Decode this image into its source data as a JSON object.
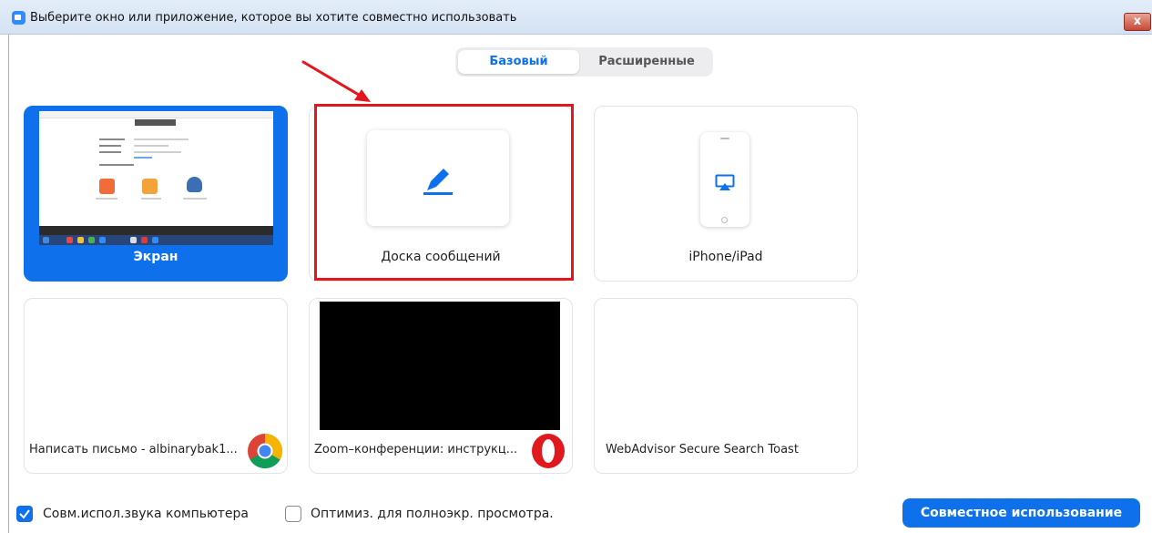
{
  "window": {
    "title": "Выберите окно или приложение, которое вы хотите совместно использовать",
    "close_glyph": "x"
  },
  "tabs": [
    {
      "label": "Базовый",
      "active": true
    },
    {
      "label": "Расширенные",
      "active": false
    }
  ],
  "share_options": [
    {
      "label": "Экран",
      "icon": "screen-thumbnail",
      "selected": true
    },
    {
      "label": "Доска сообщений",
      "icon": "pen-icon",
      "selected": false,
      "highlighted": true
    },
    {
      "label": "iPhone/iPad",
      "icon": "airplay-icon",
      "selected": false
    }
  ],
  "windows": [
    {
      "label": "Написать письмо - albinarybak1...",
      "icon": "chrome-icon"
    },
    {
      "label": "Zoom–конференции: инструкц...",
      "icon": "opera-icon",
      "preview": "black"
    },
    {
      "label": "WebAdvisor Secure Search Toast",
      "icon": null
    }
  ],
  "footer": {
    "share_audio_label": "Совм.испол.звука компьютера",
    "share_audio_checked": true,
    "optimize_label": "Оптимиз. для полноэкр. просмотра.",
    "optimize_checked": false,
    "share_button_label": "Совместное использование"
  },
  "colors": {
    "accent": "#0e71eb",
    "highlight_box": "#e8141b",
    "annotation_arrow": "#e8141b"
  }
}
